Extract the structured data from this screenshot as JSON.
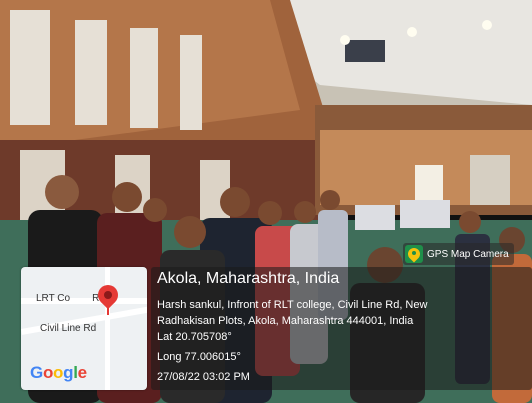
{
  "badge": {
    "label": "GPS Map Camera",
    "icon": "gps-map-camera-logo"
  },
  "map": {
    "road_label_1": "LRT Co",
    "road_label_1_suffix": "Rd",
    "road_label_2": "Civil Line Rd",
    "brand": "Google"
  },
  "location": {
    "title": "Akola, Maharashtra, India",
    "address_line": "Harsh sankul, Infront of RLT college, Civil Line Rd, New Radhakisan Plots, Akola, Maharashtra 444001, India",
    "lat": "Lat 20.705708°",
    "long": "Long 77.006015°",
    "datetime": "27/08/22 03:02 PM"
  }
}
